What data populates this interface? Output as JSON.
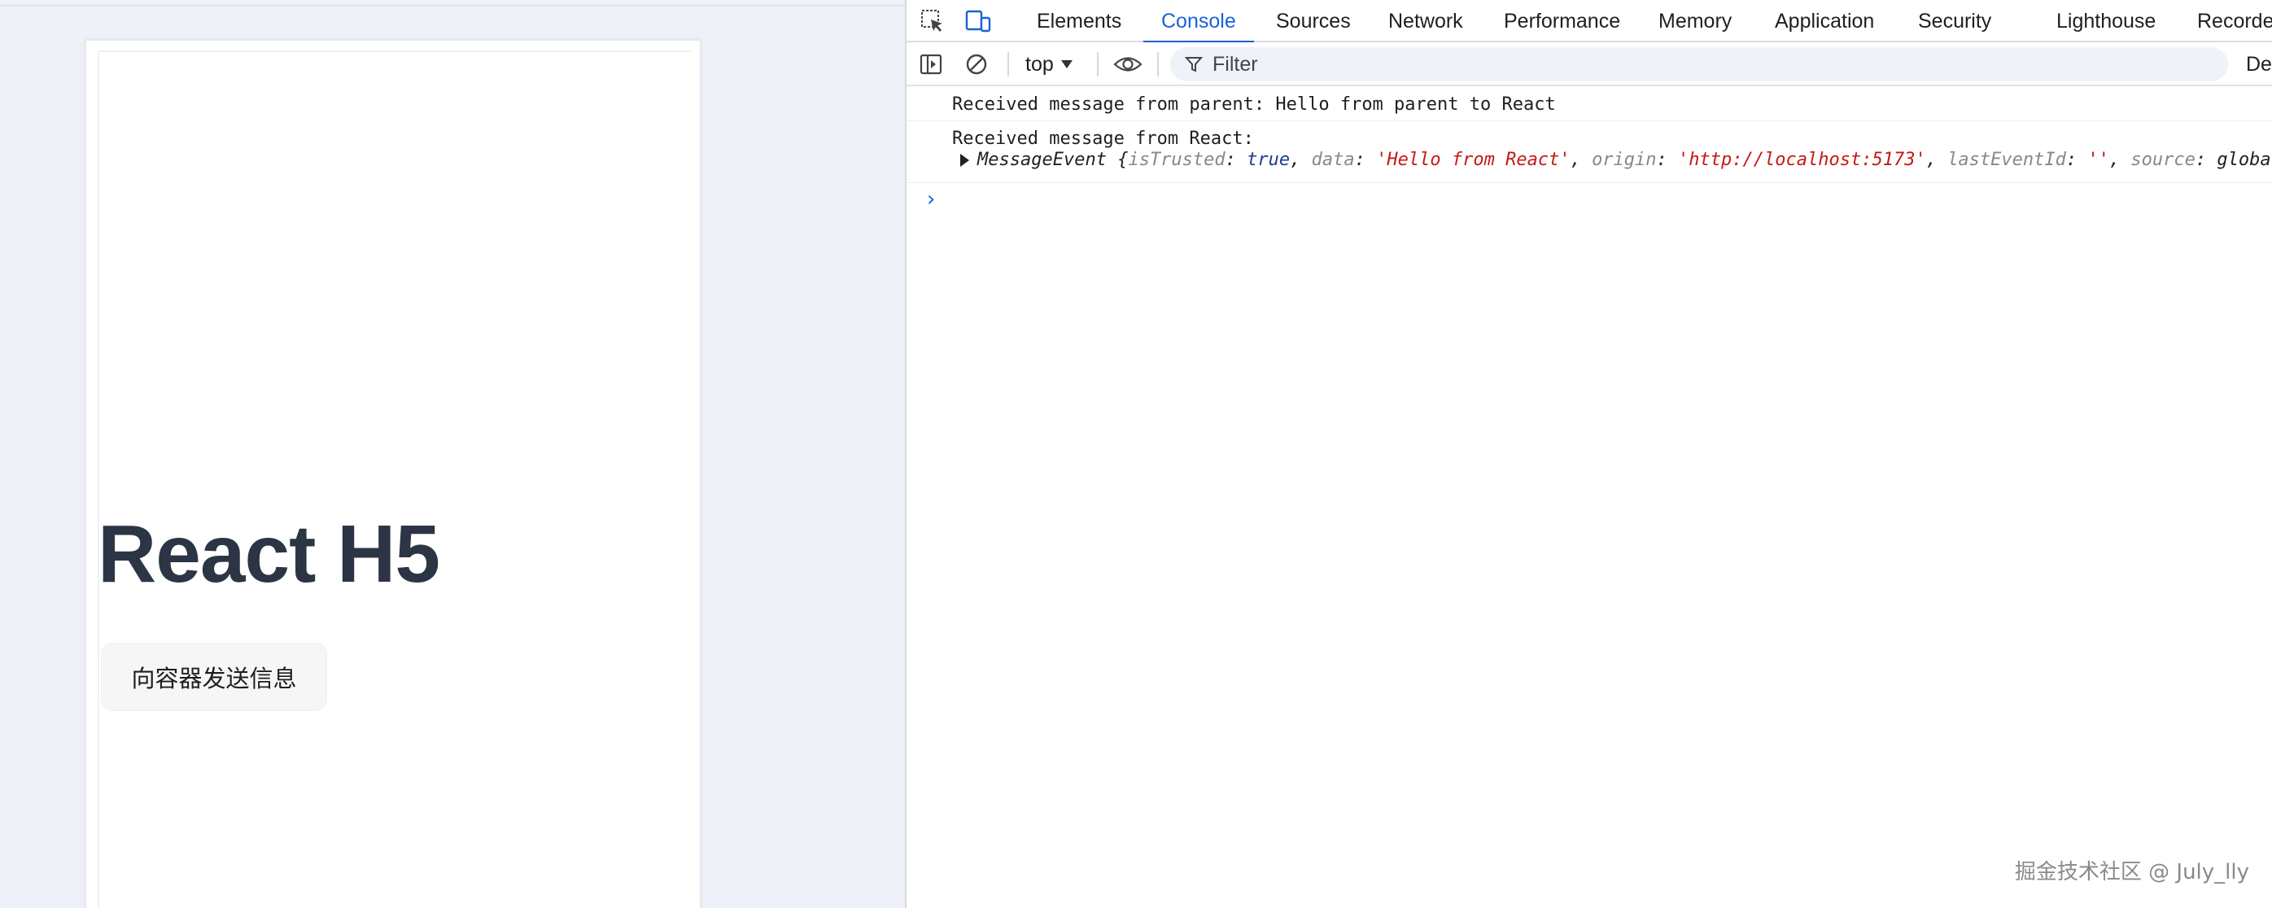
{
  "page": {
    "title": "React H5",
    "send_button_label": "向容器发送信息"
  },
  "devtools": {
    "tabs": [
      {
        "label": "Elements",
        "active": false
      },
      {
        "label": "Console",
        "active": true
      },
      {
        "label": "Sources",
        "active": false
      },
      {
        "label": "Network",
        "active": false
      },
      {
        "label": "Performance",
        "active": false
      },
      {
        "label": "Memory",
        "active": false
      },
      {
        "label": "Application",
        "active": false
      },
      {
        "label": "Security",
        "active": false
      },
      {
        "label": "Lighthouse",
        "active": false
      },
      {
        "label": "Recorde",
        "active": false
      }
    ],
    "toolbar": {
      "context": "top",
      "filter_placeholder": "Filter",
      "levels_label": "De"
    },
    "accent_color": "#1a62d6",
    "console": {
      "line1": "Received message from parent: Hello from parent to React",
      "line2": "Received message from React:",
      "event_type": "MessageEvent",
      "is_trusted_key": "isTrusted",
      "is_trusted_val": "true",
      "data_key": "data",
      "data_val": "'Hello from React'",
      "origin_key": "origin",
      "origin_val": "'http://localhost:5173'",
      "last_event_id_key": "lastEventId",
      "last_event_id_val": "''",
      "source_key": "source",
      "source_val": "globa"
    }
  },
  "watermark": "掘金技术社区 @ July_lly"
}
